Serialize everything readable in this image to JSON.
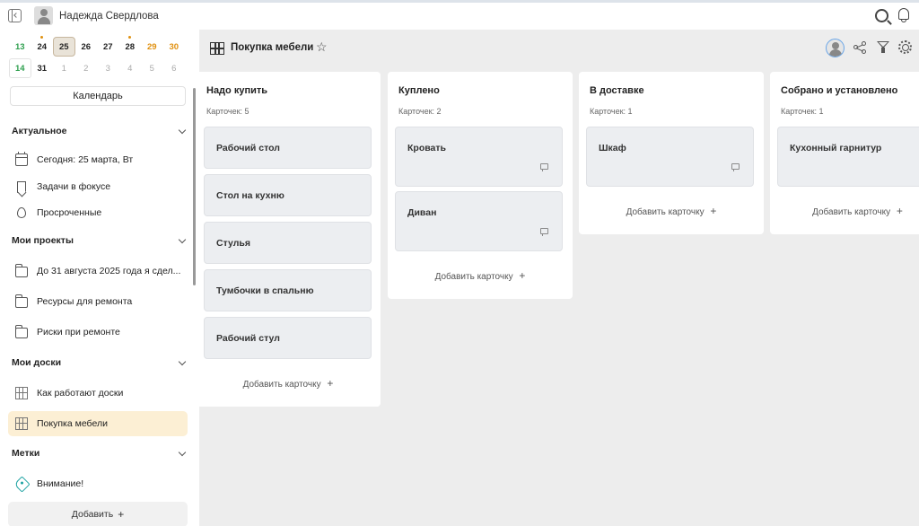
{
  "header": {
    "user_name": "Надежда Свердлова"
  },
  "calendar": {
    "row1": [
      {
        "d": "13",
        "cls": "green"
      },
      {
        "d": "24",
        "cls": "dot"
      },
      {
        "d": "25",
        "cls": "selected"
      },
      {
        "d": "26",
        "cls": ""
      },
      {
        "d": "27",
        "cls": ""
      },
      {
        "d": "28",
        "cls": "dot"
      },
      {
        "d": "29",
        "cls": "orange"
      },
      {
        "d": "30",
        "cls": "orange"
      }
    ],
    "row2": [
      {
        "d": "14",
        "cls": "green today-box"
      },
      {
        "d": "31",
        "cls": ""
      },
      {
        "d": "1",
        "cls": "muted"
      },
      {
        "d": "2",
        "cls": "muted"
      },
      {
        "d": "3",
        "cls": "muted"
      },
      {
        "d": "4",
        "cls": "muted"
      },
      {
        "d": "5",
        "cls": "muted"
      },
      {
        "d": "6",
        "cls": "muted"
      }
    ],
    "button_label": "Календарь"
  },
  "sidebar": {
    "actual": {
      "title": "Актуальное",
      "items": [
        "Сегодня: 25 марта, Вт",
        "Задачи в фокусе",
        "Просроченные"
      ]
    },
    "projects": {
      "title": "Мои проекты",
      "items": [
        "До 31 августа 2025 года я сдел...",
        "Ресурсы для ремонта",
        "Риски при ремонте"
      ]
    },
    "boards": {
      "title": "Мои доски",
      "items": [
        "Как работают доски",
        "Покупка мебели"
      ]
    },
    "tags": {
      "title": "Метки",
      "items": [
        "Внимание!"
      ]
    },
    "add_label": "Добавить"
  },
  "board": {
    "title": "Покупка мебели",
    "add_card_label": "Добавить карточку",
    "columns": [
      {
        "title": "Надо купить",
        "count": "Карточек: 5",
        "cards": [
          "Рабочий стол",
          "Стол на кухню",
          "Стулья",
          "Тумбочки в спальню",
          "Рабочий стул"
        ]
      },
      {
        "title": "Куплено",
        "count": "Карточек: 2",
        "cards": [
          "Кровать",
          "Диван"
        ]
      },
      {
        "title": "В доставке",
        "count": "Карточек: 1",
        "cards": [
          "Шкаф"
        ]
      },
      {
        "title": "Собрано и установлено",
        "count": "Карточек: 1",
        "cards": [
          "Кухонный гарнитур"
        ]
      }
    ]
  }
}
